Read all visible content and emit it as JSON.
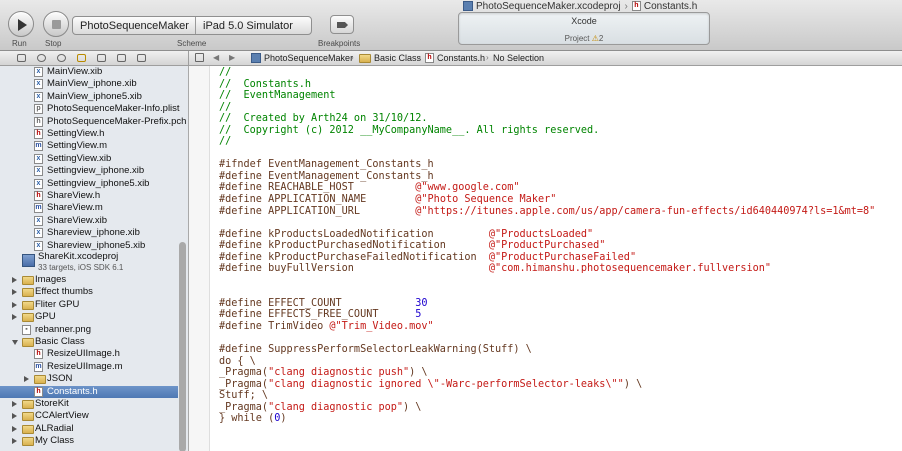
{
  "toolbar": {
    "run_label": "Run",
    "stop_label": "Stop",
    "scheme_label": "Scheme",
    "scheme_target": "PhotoSequenceMaker",
    "scheme_destination": "iPad 5.0 Simulator",
    "breakpoints_label": "Breakpoints"
  },
  "window": {
    "project_title": "PhotoSequenceMaker.xcodeproj",
    "file_title": "Constants.h"
  },
  "activity": {
    "title": "Xcode",
    "project_label": "Project",
    "warning_count": "2",
    "warning_icon": "warning-triangle-icon"
  },
  "sidebar": {
    "items": [
      {
        "label": "MainView.xib",
        "type": "xib",
        "indent": 2
      },
      {
        "label": "MainView_iphone.xib",
        "type": "xib",
        "indent": 2
      },
      {
        "label": "MainView_iphone5.xib",
        "type": "xib",
        "indent": 2
      },
      {
        "label": "PhotoSequenceMaker-Info.plist",
        "type": "plist",
        "indent": 2
      },
      {
        "label": "PhotoSequenceMaker-Prefix.pch",
        "type": "pch",
        "indent": 2
      },
      {
        "label": "SettingView.h",
        "type": "h",
        "indent": 2
      },
      {
        "label": "SettingView.m",
        "type": "m",
        "indent": 2
      },
      {
        "label": "SettingView.xib",
        "type": "xib",
        "indent": 2
      },
      {
        "label": "Settingview_iphone.xib",
        "type": "xib",
        "indent": 2
      },
      {
        "label": "Settingview_iphone5.xib",
        "type": "xib",
        "indent": 2
      },
      {
        "label": "ShareView.h",
        "type": "h",
        "indent": 2
      },
      {
        "label": "ShareView.m",
        "type": "m",
        "indent": 2
      },
      {
        "label": "ShareView.xib",
        "type": "xib",
        "indent": 2
      },
      {
        "label": "Shareview_iphone.xib",
        "type": "xib",
        "indent": 2
      },
      {
        "label": "Shareview_iphone5.xib",
        "type": "xib",
        "indent": 2
      },
      {
        "label": "ShareKit.xcodeproj",
        "sub": "33 targets, iOS SDK 6.1",
        "type": "project",
        "indent": 1
      },
      {
        "label": "Images",
        "type": "folder",
        "indent": 1,
        "disclosure": "closed"
      },
      {
        "label": "Effect thumbs",
        "type": "folder",
        "indent": 1,
        "disclosure": "closed"
      },
      {
        "label": "Fliter GPU",
        "type": "folder",
        "indent": 1,
        "disclosure": "closed"
      },
      {
        "label": "GPU",
        "type": "folder",
        "indent": 1,
        "disclosure": "closed"
      },
      {
        "label": "rebanner.png",
        "type": "png",
        "indent": 1
      },
      {
        "label": "Basic Class",
        "type": "folder",
        "indent": 1,
        "disclosure": "open"
      },
      {
        "label": "ResizeUIImage.h",
        "type": "h",
        "indent": 2
      },
      {
        "label": "ResizeUIImage.m",
        "type": "m",
        "indent": 2
      },
      {
        "label": "JSON",
        "type": "folder",
        "indent": 2,
        "disclosure": "closed"
      },
      {
        "label": "Constants.h",
        "type": "h",
        "indent": 2,
        "selected": true
      },
      {
        "label": "StoreKit",
        "type": "folder",
        "indent": 1,
        "disclosure": "closed"
      },
      {
        "label": "CCAlertView",
        "type": "folder",
        "indent": 1,
        "disclosure": "closed"
      },
      {
        "label": "ALRadial",
        "type": "folder",
        "indent": 1,
        "disclosure": "closed"
      },
      {
        "label": "My Class",
        "type": "folder",
        "indent": 1,
        "disclosure": "closed"
      }
    ]
  },
  "jumpbar": {
    "crumbs": [
      "PhotoSequenceMaker",
      "Basic Class",
      "Constants.h",
      "No Selection"
    ]
  },
  "editor": {
    "lines": [
      [
        [
          "cm",
          "//"
        ]
      ],
      [
        [
          "cm",
          "//  Constants.h"
        ]
      ],
      [
        [
          "cm",
          "//  EventManagement"
        ]
      ],
      [
        [
          "cm",
          "//"
        ]
      ],
      [
        [
          "cm",
          "//  Created by Arth24 on 31/10/12."
        ]
      ],
      [
        [
          "cm",
          "//  Copyright (c) 2012 __MyCompanyName__. All rights reserved."
        ]
      ],
      [
        [
          "cm",
          "//"
        ]
      ],
      [],
      [
        [
          "pp",
          "#ifndef EventManagement_Constants_h"
        ]
      ],
      [
        [
          "pp",
          "#define EventManagement_Constants_h"
        ]
      ],
      [
        [
          "pp",
          "#define REACHABLE_HOST          "
        ],
        [
          "str",
          "@\"www.google.com\""
        ]
      ],
      [
        [
          "pp",
          "#define APPLICATION_NAME        "
        ],
        [
          "str",
          "@\"Photo Sequence Maker\""
        ]
      ],
      [
        [
          "pp",
          "#define APPLICATION_URL         "
        ],
        [
          "str",
          "@\"https://itunes.apple.com/us/app/camera-fun-effects/id640440974?ls=1&mt=8\""
        ]
      ],
      [],
      [
        [
          "pp",
          "#define kProductsLoadedNotification         "
        ],
        [
          "str",
          "@\"ProductsLoaded\""
        ]
      ],
      [
        [
          "pp",
          "#define kProductPurchasedNotification       "
        ],
        [
          "str",
          "@\"ProductPurchased\""
        ]
      ],
      [
        [
          "pp",
          "#define kProductPurchaseFailedNotification  "
        ],
        [
          "str",
          "@\"ProductPurchaseFailed\""
        ]
      ],
      [
        [
          "pp",
          "#define buyFullVersion                      "
        ],
        [
          "str",
          "@\"com.himanshu.photosequencemaker.fullversion\""
        ]
      ],
      [],
      [],
      [
        [
          "pp",
          "#define EFFECT_COUNT            "
        ],
        [
          "num",
          "30"
        ]
      ],
      [
        [
          "pp",
          "#define EFFECTS_FREE_COUNT      "
        ],
        [
          "num",
          "5"
        ]
      ],
      [
        [
          "pp",
          "#define TrimVideo "
        ],
        [
          "str",
          "@\"Trim_Video.mov\""
        ]
      ],
      [],
      [
        [
          "pp",
          "#define SuppressPerformSelectorLeakWarning(Stuff) \\"
        ]
      ],
      [
        [
          "pp",
          "do { \\"
        ]
      ],
      [
        [
          "pp",
          "_Pragma("
        ],
        [
          "str",
          "\"clang diagnostic push\""
        ],
        [
          "pp",
          ") \\"
        ]
      ],
      [
        [
          "pp",
          "_Pragma("
        ],
        [
          "str",
          "\"clang diagnostic ignored \\\"-Warc-performSelector-leaks\\\"\""
        ],
        [
          "pp",
          ") \\"
        ]
      ],
      [
        [
          "pp",
          "Stuff; \\"
        ]
      ],
      [
        [
          "pp",
          "_Pragma("
        ],
        [
          "str",
          "\"clang diagnostic pop\""
        ],
        [
          "pp",
          ") \\"
        ]
      ],
      [
        [
          "pp",
          "} while ("
        ],
        [
          "num",
          "0"
        ],
        [
          "pp",
          ")"
        ]
      ],
      [],
      []
    ]
  }
}
